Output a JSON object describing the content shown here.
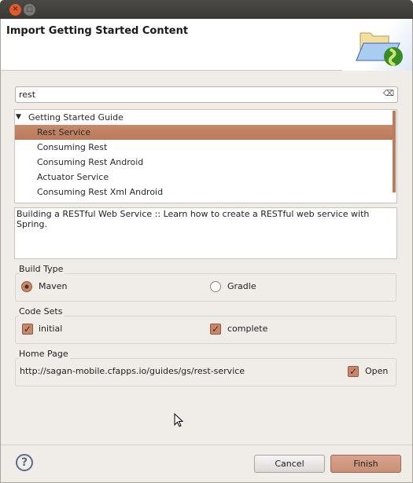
{
  "window": {
    "close_icon": "close-icon",
    "maximize_icon": "maximize-icon"
  },
  "header": {
    "title": "Import Getting Started Content",
    "banner_icon": "folder-spring-icon"
  },
  "search": {
    "value": "rest",
    "clear_icon": "clear-icon"
  },
  "tree": {
    "category": "Getting Started Guide",
    "items": [
      {
        "label": "Rest Service",
        "selected": true
      },
      {
        "label": "Consuming Rest"
      },
      {
        "label": "Consuming Rest Android"
      },
      {
        "label": "Actuator Service"
      },
      {
        "label": "Consuming Rest Xml Android"
      }
    ]
  },
  "description": "Building a RESTful Web Service :: Learn how to create a RESTful web service with Spring.",
  "build_type": {
    "label": "Build Type",
    "options": [
      "Maven",
      "Gradle"
    ],
    "selected": "Maven"
  },
  "code_sets": {
    "label": "Code Sets",
    "initial": "initial",
    "complete": "complete",
    "initial_checked": true,
    "complete_checked": true
  },
  "home_page": {
    "label": "Home Page",
    "url": "http://sagan-mobile.cfapps.io/guides/gs/rest-service",
    "open": "Open",
    "open_checked": true
  },
  "footer": {
    "help_icon": "help-icon",
    "cancel": "Cancel",
    "finish": "Finish"
  },
  "colors": {
    "accent": "#c07a5c",
    "background": "#f0ede9"
  }
}
